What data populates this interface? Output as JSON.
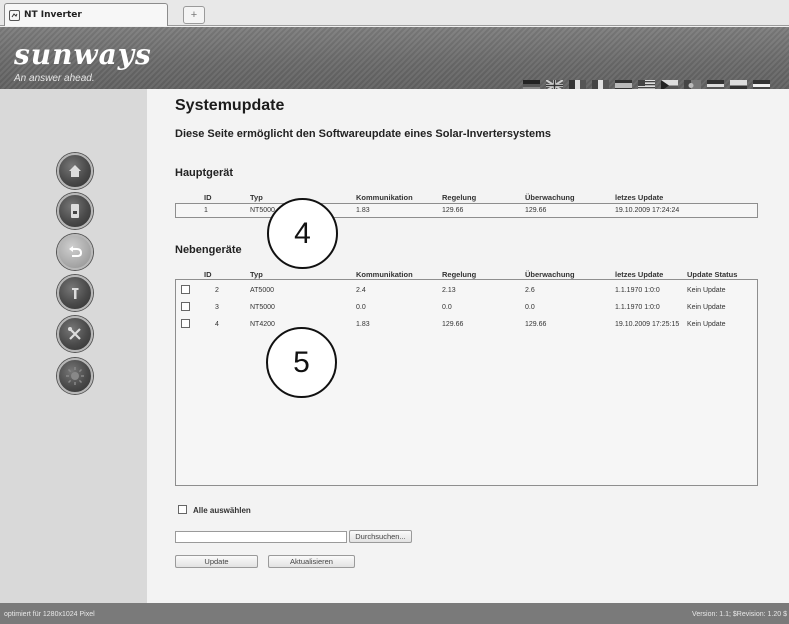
{
  "browser": {
    "tab_title": "NT Inverter",
    "new_tab_label": "+"
  },
  "header": {
    "logo": "sunways",
    "tagline": "An answer ahead.",
    "flag_icons": [
      "german-flag-icon",
      "uk-flag-icon",
      "french-flag-icon",
      "italian-flag-icon",
      "spanish-flag-icon",
      "greek-flag-icon",
      "czech-flag-icon",
      "portuguese-flag-icon",
      "dutch-flag-icon",
      "other-flag-icon",
      "other-flag-icon-2"
    ]
  },
  "nav": {
    "icons": [
      "home-icon",
      "inverter-icon",
      "update-icon",
      "info-icon",
      "tools-icon",
      "sun-icon"
    ],
    "active_index": 2
  },
  "page": {
    "title": "Systemupdate",
    "subtitle": "Diese Seite ermöglicht den Softwareupdate eines Solar-Invertersystems"
  },
  "main_device": {
    "section_title": "Hauptgerät",
    "columns": [
      "ID",
      "Typ",
      "Kommunikation",
      "Regelung",
      "Überwachung",
      "letzes Update"
    ],
    "rows": [
      {
        "id": "1",
        "typ": "NT5000",
        "kommunikation": "1.83",
        "regelung": "129.66",
        "ueberwachung": "129.66",
        "update": "19.10.2009 17:24:24"
      }
    ]
  },
  "sub_devices": {
    "section_title": "Nebengeräte",
    "columns": [
      "ID",
      "Typ",
      "Kommunikation",
      "Regelung",
      "Überwachung",
      "letzes Update",
      "Update Status"
    ],
    "rows": [
      {
        "id": "2",
        "typ": "AT5000",
        "kommunikation": "2.4",
        "regelung": "2.13",
        "ueberwachung": "2.6",
        "update": "1.1.1970 1:0:0",
        "status": "Kein Update"
      },
      {
        "id": "3",
        "typ": "NT5000",
        "kommunikation": "0.0",
        "regelung": "0.0",
        "ueberwachung": "0.0",
        "update": "1.1.1970 1:0:0",
        "status": "Kein Update"
      },
      {
        "id": "4",
        "typ": "NT4200",
        "kommunikation": "1.83",
        "regelung": "129.66",
        "ueberwachung": "129.66",
        "update": "19.10.2009 17:25:15",
        "status": "Kein Update"
      }
    ]
  },
  "callouts": [
    "4",
    "5"
  ],
  "controls": {
    "select_all_label": "Alle auswählen",
    "file_value": "",
    "browse_label": "Durchsuchen...",
    "update_label": "Update",
    "refresh_label": "Aktualisieren"
  },
  "status": {
    "left": "optimiert für 1280x1024 Pixel",
    "right": "Version: 1.1; $Revision: 1.20 $"
  }
}
